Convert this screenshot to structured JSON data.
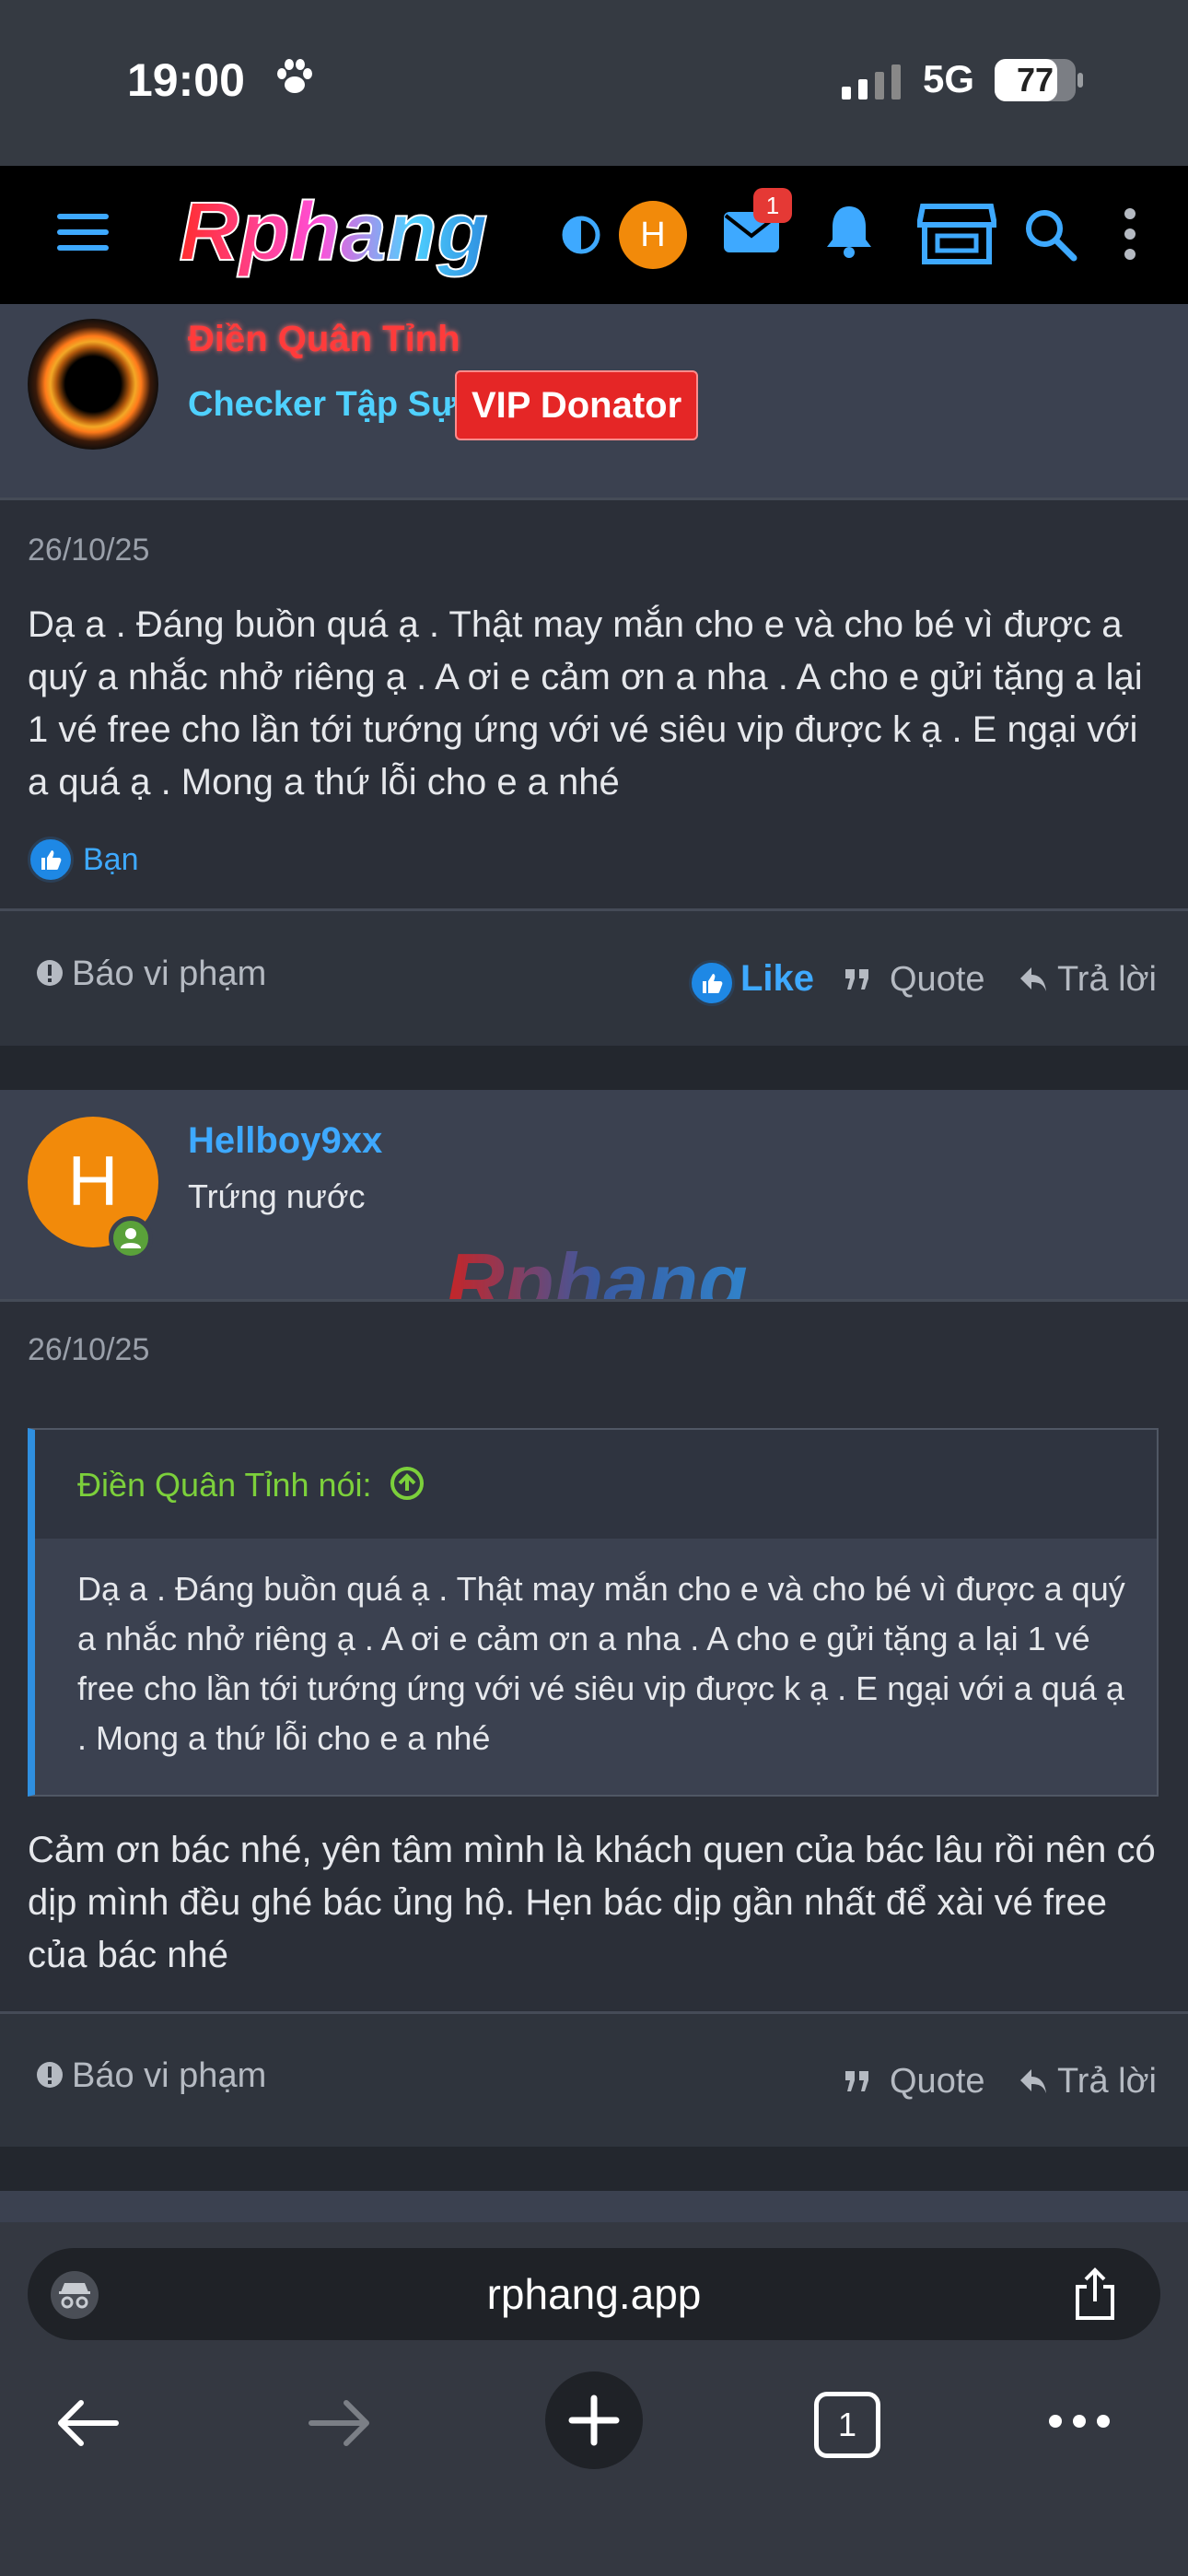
{
  "status_bar": {
    "time": "19:00",
    "network": "5G",
    "battery": "77"
  },
  "navbar": {
    "logo_text": "Rphang",
    "avatar_letter": "H",
    "mail_badge": "1"
  },
  "post1": {
    "author": "Điền Quân Tỉnh",
    "user_title": "Checker Tập Sự",
    "vip_badge": "VIP Donator",
    "date": "26/10/25",
    "content": "Dạ a . Đáng buồn quá ạ . Thật may mắn cho e và cho bé vì được a quý a nhắc nhở riêng ạ . A ơi e cảm ơn a nha . A cho e gửi tặng a lại 1 vé free cho lần tới tướng ứng với vé siêu vip được k ạ . E ngại với a quá ạ . Mong a thứ lỗi cho e a nhé",
    "reaction_by": "Bạn",
    "report": "Báo vi phạm",
    "like": "Like",
    "quote": "Quote",
    "reply": "Trả lời"
  },
  "post2": {
    "author": "Hellboy9xx",
    "avatar_letter": "H",
    "user_title": "Trứng nước",
    "watermark": "Rphang",
    "date": "26/10/25",
    "quote_author": "Điền Quân Tỉnh nói:",
    "quote_text": "Dạ a . Đáng buồn quá ạ . Thật may mắn cho e và cho bé vì được a quý a nhắc nhở riêng ạ . A ơi e cảm ơn a nha . A cho e gửi tặng a lại 1 vé free cho lần tới tướng ứng với vé siêu vip được k ạ . E ngại với a quá ạ . Mong a thứ lỗi cho e a nhé",
    "content": "Cảm ơn bác nhé, yên tâm mình là khách quen của bác lâu rồi nên có dịp mình đều ghé bác ủng hộ. Hẹn bác dịp gần nhất để xài vé free của bác nhé",
    "report": "Báo vi phạm",
    "quote": "Quote",
    "reply": "Trả lời"
  },
  "browser": {
    "url": "rphang.app",
    "tab_count": "1"
  }
}
